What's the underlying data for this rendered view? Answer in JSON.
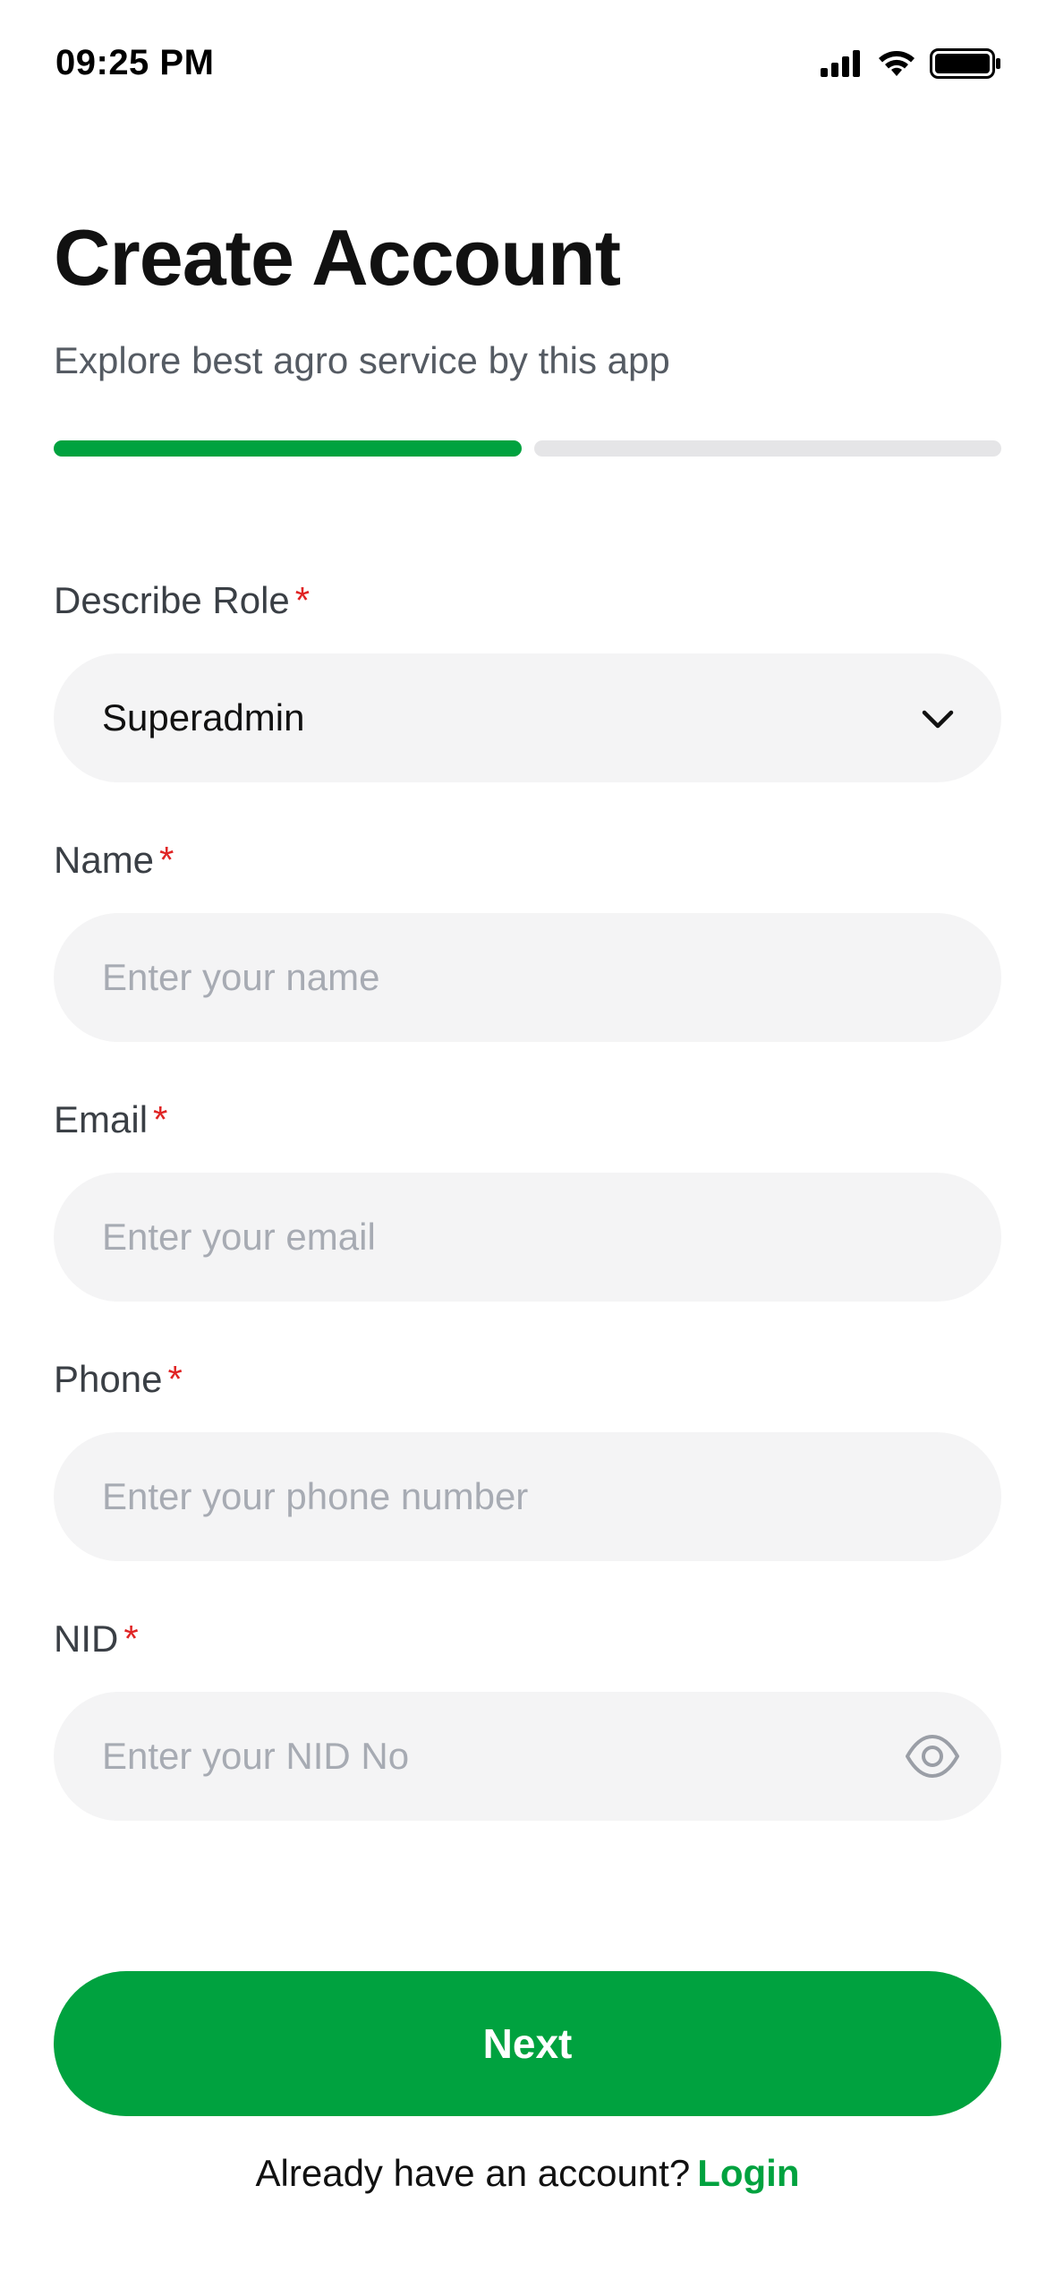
{
  "status_bar": {
    "time": "09:25 PM",
    "icons": [
      "signal-icon",
      "wifi-icon",
      "battery-icon"
    ]
  },
  "header": {
    "title": "Create Account",
    "subtitle": "Explore best agro service by this app"
  },
  "progress": {
    "current_step": 1,
    "total_steps": 2,
    "active_color": "#00a23f",
    "inactive_color": "#e5e5e7"
  },
  "form": {
    "role": {
      "label": "Describe Role",
      "required_mark": "*",
      "value": "Superadmin",
      "icon": "chevron-down-icon"
    },
    "name": {
      "label": "Name",
      "required_mark": "*",
      "placeholder": "Enter your name",
      "value": ""
    },
    "email": {
      "label": "Email",
      "required_mark": "*",
      "placeholder": "Enter your email",
      "value": ""
    },
    "phone": {
      "label": "Phone",
      "required_mark": "*",
      "placeholder": "Enter your phone number",
      "value": ""
    },
    "nid": {
      "label": "NID",
      "required_mark": "*",
      "placeholder": "Enter your NID No",
      "value": "",
      "icon": "eye-icon"
    }
  },
  "actions": {
    "next_label": "Next",
    "footer_prompt": "Already have an account?",
    "login_label": "Login"
  },
  "colors": {
    "brand": "#00a23f",
    "required": "#e02424",
    "input_bg": "#f4f4f5"
  }
}
